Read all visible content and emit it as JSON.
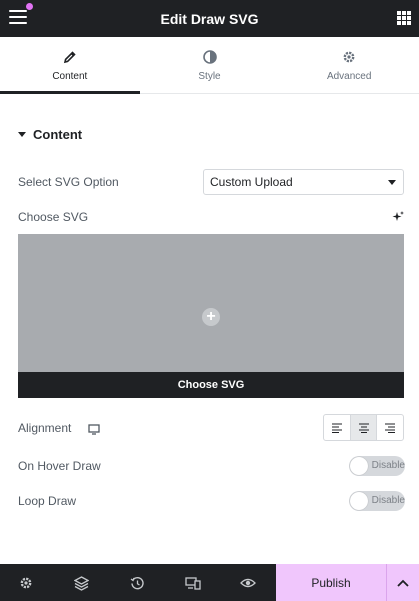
{
  "header": {
    "title": "Edit Draw SVG",
    "menu_icon": "hamburger-icon",
    "apps_icon": "grid-icon",
    "notification_color": "#e173f4"
  },
  "tabs": [
    {
      "label": "Content",
      "icon": "pencil-icon",
      "active": true
    },
    {
      "label": "Style",
      "icon": "contrast-icon",
      "active": false
    },
    {
      "label": "Advanced",
      "icon": "gear-icon",
      "active": false
    }
  ],
  "section": {
    "title": "Content"
  },
  "svg_option": {
    "label": "Select SVG Option",
    "value": "Custom Upload"
  },
  "choose_svg": {
    "label": "Choose SVG",
    "button_label": "Choose SVG"
  },
  "alignment": {
    "label": "Alignment",
    "options": [
      "left",
      "center",
      "right"
    ],
    "selected": "center"
  },
  "on_hover_draw": {
    "label": "On Hover Draw",
    "state": "Disable"
  },
  "loop_draw": {
    "label": "Loop Draw",
    "state": "Disable"
  },
  "footer": {
    "icons": [
      "gear-icon",
      "layers-icon",
      "history-icon",
      "responsive-icon",
      "eye-icon"
    ],
    "publish_label": "Publish",
    "accent_color": "#f0c6fc"
  }
}
